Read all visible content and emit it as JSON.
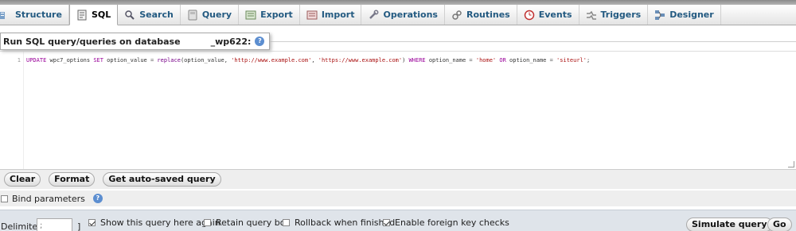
{
  "tabs": [
    {
      "label": "Structure",
      "icon": "structure-icon"
    },
    {
      "label": "SQL",
      "icon": "sql-icon",
      "active": true
    },
    {
      "label": "Search",
      "icon": "search-icon"
    },
    {
      "label": "Query",
      "icon": "query-icon"
    },
    {
      "label": "Export",
      "icon": "export-icon"
    },
    {
      "label": "Import",
      "icon": "import-icon"
    },
    {
      "label": "Operations",
      "icon": "wrench-icon"
    },
    {
      "label": "Routines",
      "icon": "routines-icon"
    },
    {
      "label": "Events",
      "icon": "clock-icon"
    },
    {
      "label": "Triggers",
      "icon": "triggers-icon"
    },
    {
      "label": "Designer",
      "icon": "designer-icon"
    }
  ],
  "legend": {
    "title": "Run SQL query/queries on database",
    "database": "_wp622:"
  },
  "editor": {
    "line_number": "1",
    "code": {
      "k1": "UPDATE",
      "t1": " wpc7_options ",
      "k2": "SET",
      "t2": " option_value ",
      "o1": "=",
      "t3": " ",
      "f1": "replace",
      "t4": "(option_value, ",
      "s1": "'http://www.example.com'",
      "t5": ", ",
      "s2": "'https://www.example.com'",
      "t6": ") ",
      "k3": "WHERE",
      "t7": " option_name ",
      "o2": "=",
      "t8": " ",
      "s3": "'home'",
      "t9": " ",
      "k4": "OR",
      "t10": " option_name ",
      "o3": "=",
      "t11": " ",
      "s4": "'siteurl'",
      "t12": ";"
    }
  },
  "buttons": {
    "clear": "Clear",
    "format": "Format",
    "auto_saved": "Get auto-saved query"
  },
  "bind_parameters": {
    "label": "Bind parameters",
    "checked": false
  },
  "bottom": {
    "delimiter_label": "Delimiter",
    "delimiter_value": ";",
    "bracket": "]",
    "show_query": {
      "label": "Show this query here again",
      "checked": true
    },
    "retain_box": {
      "label": "Retain query box",
      "checked": false
    },
    "rollback": {
      "label": "Rollback when finished",
      "checked": false
    },
    "foreign_keys": {
      "label": "Enable foreign key checks",
      "checked": true
    },
    "simulate": "Simulate query",
    "go": "Go"
  },
  "colors": {
    "tab_text": "#235a81",
    "keyword": "#990099",
    "string": "#aa1111",
    "bottom_bar": "#dfe4ea"
  }
}
